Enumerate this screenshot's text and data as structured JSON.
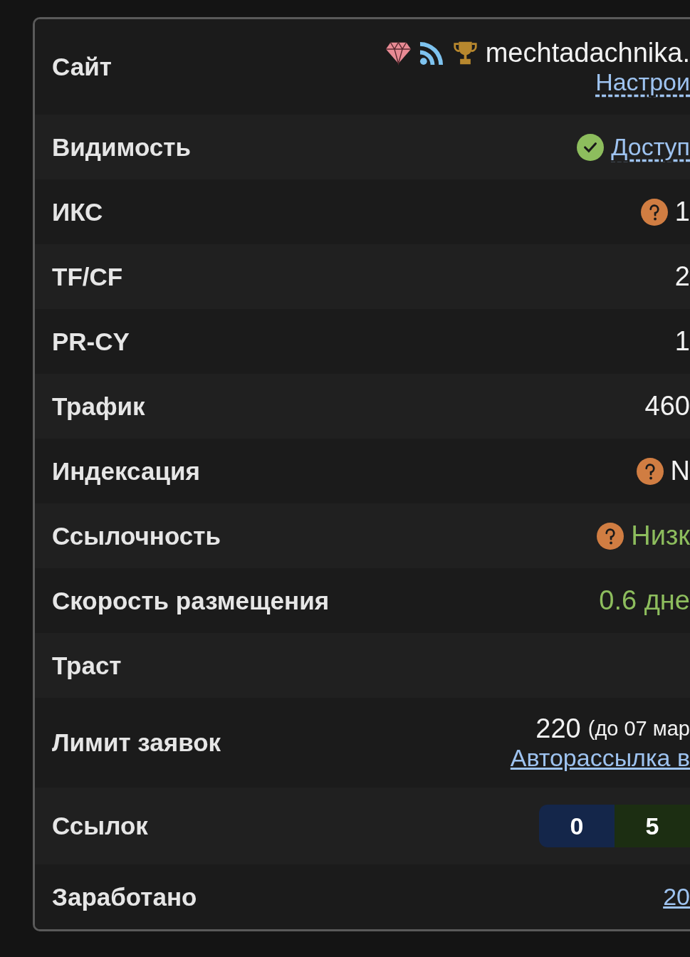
{
  "rows": [
    {
      "label": "Сайт",
      "value": {
        "kind": "site",
        "name": "mechtadachnika.",
        "link": "Настрои"
      }
    },
    {
      "label": "Видимость",
      "value": {
        "kind": "status",
        "link": "Доступ"
      }
    },
    {
      "label": "ИКС",
      "value": {
        "kind": "text",
        "text": "1",
        "hint": true,
        "color": "#f2f2f2"
      }
    },
    {
      "label": "TF/CF",
      "value": {
        "kind": "text",
        "text": "2",
        "hint": false,
        "color": "#f2f2f2"
      }
    },
    {
      "label": "PR-CY",
      "value": {
        "kind": "text",
        "text": "1",
        "hint": false,
        "color": "#f2f2f2"
      }
    },
    {
      "label": "Трафик",
      "value": {
        "kind": "text",
        "text": "460",
        "hint": false,
        "color": "#f2f2f2"
      }
    },
    {
      "label": "Индексация",
      "value": {
        "kind": "text",
        "text": "N",
        "hint": true,
        "color": "#f2f2f2"
      }
    },
    {
      "label": "Ссылочность",
      "value": {
        "kind": "text",
        "text": "Низк",
        "hint": true,
        "color": "#8dbd5d"
      }
    },
    {
      "label": "Скорость размещения",
      "value": {
        "kind": "text",
        "text": "0.6 дне",
        "hint": false,
        "color": "#8dbd5d"
      }
    },
    {
      "label": "Траст"
    },
    {
      "label": "Лимит заявок",
      "value": {
        "kind": "limit",
        "number": "220",
        "note": "(до 07 мар",
        "link": "Авторассылка в"
      }
    },
    {
      "label": "Ссылок",
      "value": {
        "kind": "badges",
        "badges": [
          {
            "text": "0",
            "color": "#14264a"
          },
          {
            "text": "5",
            "color": "#1c2e12"
          }
        ]
      }
    },
    {
      "label": "Заработано",
      "value": {
        "kind": "link",
        "link": "20"
      }
    }
  ]
}
